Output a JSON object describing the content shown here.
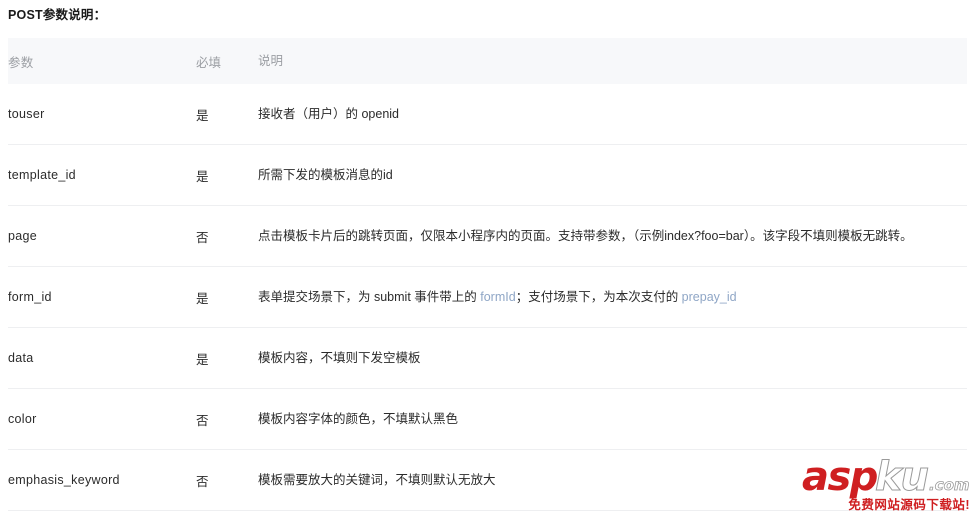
{
  "page_title": "POST参数说明：",
  "table": {
    "headers": [
      "参数",
      "必填",
      "说明"
    ],
    "rows": [
      {
        "param": "touser",
        "required": "是",
        "desc_parts": [
          {
            "type": "text",
            "value": "接收者（用户）的 openid"
          }
        ]
      },
      {
        "param": "template_id",
        "required": "是",
        "desc_parts": [
          {
            "type": "text",
            "value": "所需下发的模板消息的id"
          }
        ]
      },
      {
        "param": "page",
        "required": "否",
        "desc_parts": [
          {
            "type": "text",
            "value": "点击模板卡片后的跳转页面，仅限本小程序内的页面。支持带参数，（示例index?foo=bar）。该字段不填则模板无跳转。"
          }
        ]
      },
      {
        "param": "form_id",
        "required": "是",
        "desc_parts": [
          {
            "type": "text",
            "value": "表单提交场景下，为 submit 事件带上的 "
          },
          {
            "type": "link",
            "value": "formId"
          },
          {
            "type": "text",
            "value": "；支付场景下，为本次支付的 "
          },
          {
            "type": "link",
            "value": "prepay_id"
          }
        ]
      },
      {
        "param": "data",
        "required": "是",
        "desc_parts": [
          {
            "type": "text",
            "value": "模板内容，不填则下发空模板"
          }
        ]
      },
      {
        "param": "color",
        "required": "否",
        "desc_parts": [
          {
            "type": "text",
            "value": "模板内容字体的颜色，不填默认黑色"
          }
        ]
      },
      {
        "param": "emphasis_keyword",
        "required": "否",
        "desc_parts": [
          {
            "type": "text",
            "value": "模板需要放大的关键词，不填则默认无放大"
          }
        ]
      }
    ]
  },
  "watermark": {
    "brand_red": "asp",
    "brand_outline": "ku",
    "brand_tld": ".com",
    "tagline": "免费网站源码下载站!",
    "colors": {
      "red": "#cf1f21",
      "outline": "#9a9a9a"
    }
  },
  "colors": {
    "header_bg": "#f7f8fa",
    "header_text": "#9b9ea3",
    "body_text": "#2b2b2b",
    "row_divider": "#eeeff1",
    "link": "#8fa6c6"
  }
}
